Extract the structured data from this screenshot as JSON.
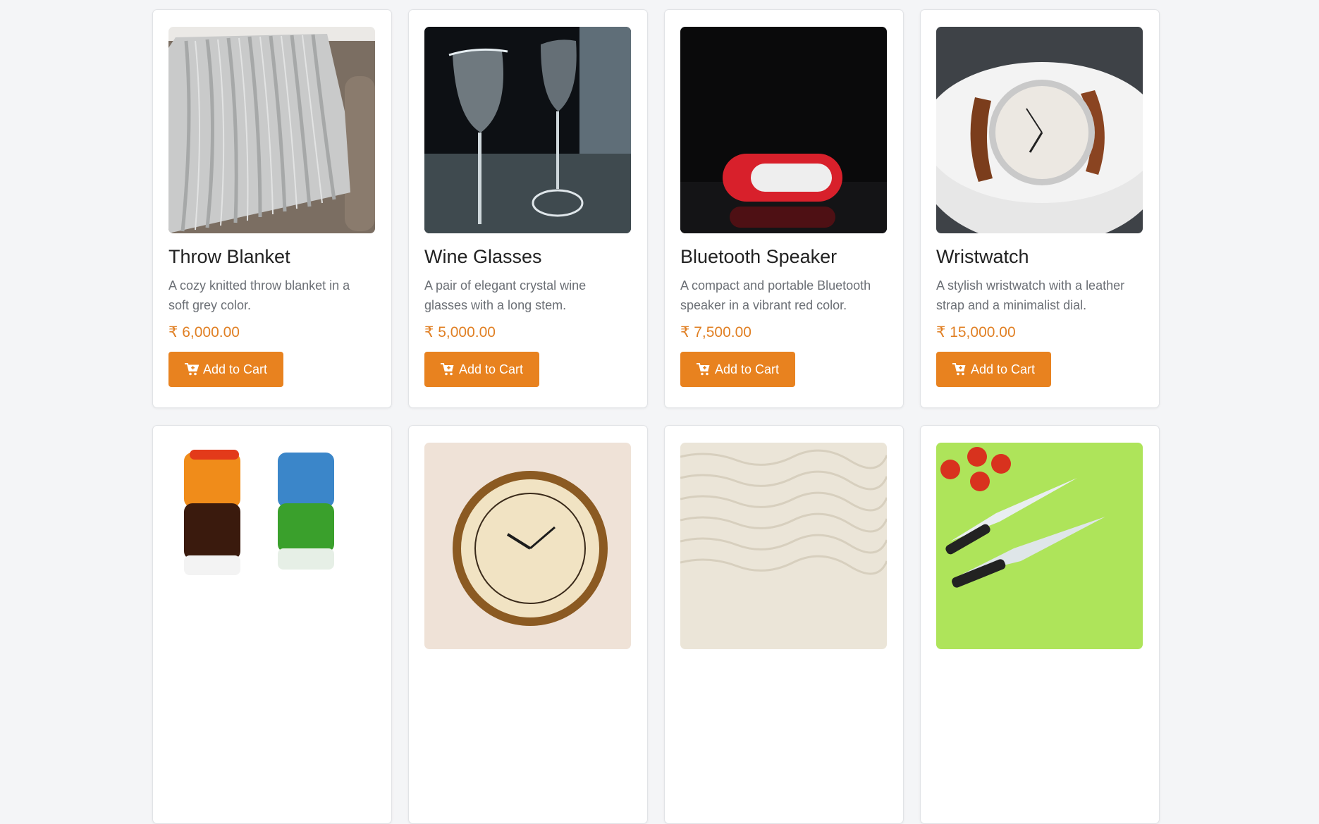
{
  "currency_symbol": "₹",
  "accent_color": "#e8821f",
  "price_color": "#e07f23",
  "products": [
    {
      "name": "Throw Blanket",
      "description": "A cozy knitted throw blanket in a soft grey color.",
      "price": "₹ 6,000.00",
      "button": "Add to Cart",
      "image": "grey-knitted-blanket-on-sofa"
    },
    {
      "name": "Wine Glasses",
      "description": "A pair of elegant crystal wine glasses with a long stem.",
      "price": "₹ 5,000.00",
      "button": "Add to Cart",
      "image": "crystal-wine-glasses"
    },
    {
      "name": "Bluetooth Speaker",
      "description": "A compact and portable Bluetooth speaker in a vibrant red color.",
      "price": "₹ 7,500.00",
      "button": "Add to Cart",
      "image": "red-bluetooth-speaker"
    },
    {
      "name": "Wristwatch",
      "description": "A stylish wristwatch with a leather strap and a minimalist dial.",
      "price": "₹ 15,000.00",
      "button": "Add to Cart",
      "image": "leather-strap-wristwatch"
    },
    {
      "image": "colorful-ceramic-mugs"
    },
    {
      "image": "roman-numeral-wall-clock"
    },
    {
      "image": "cream-shag-rug"
    },
    {
      "image": "kitchen-knives-with-tomatoes"
    }
  ]
}
